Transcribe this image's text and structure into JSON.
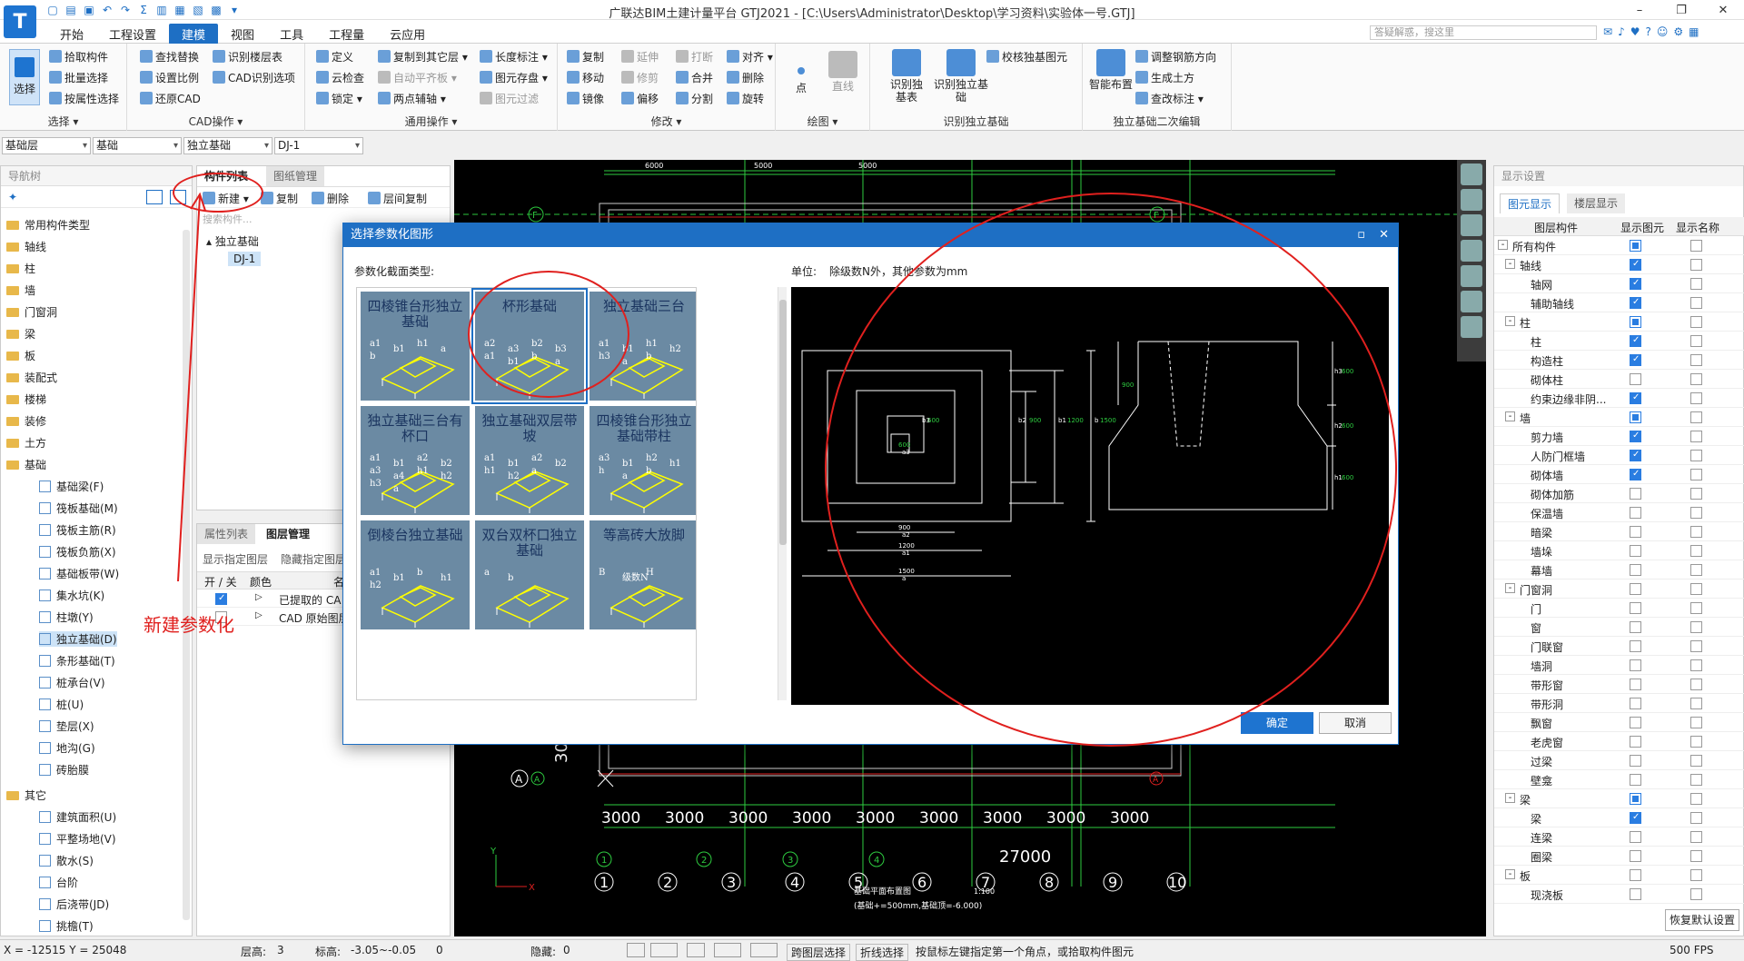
{
  "window": {
    "title": "广联达BIM土建计量平台 GTJ2021 - [C:\\Users\\Administrator\\Desktop\\学习资料\\实验体一号.GTJ]"
  },
  "menu": {
    "tabs": [
      "开始",
      "工程设置",
      "建模",
      "视图",
      "工具",
      "工程量",
      "云应用"
    ],
    "active": "建模",
    "logo": "T",
    "search_placeholder": "答疑解惑，搜这里"
  },
  "ribbon": {
    "select": {
      "label": "选择",
      "items": [
        "拾取构件",
        "批量选择",
        "按属性选择"
      ],
      "group": "选择 ▾"
    },
    "cad": {
      "items": [
        "查找替换",
        "设置比例",
        "还原CAD",
        "识别楼层表",
        "CAD识别选项"
      ],
      "group": "CAD操作 ▾"
    },
    "common": {
      "items": [
        "定义",
        "云检查",
        "锁定 ▾",
        "复制到其它层 ▾",
        "自动平齐板 ▾",
        "两点辅轴 ▾",
        "长度标注 ▾",
        "图元存盘 ▾",
        "图元过滤"
      ],
      "group": "通用操作 ▾"
    },
    "modify": {
      "items": [
        "复制",
        "移动",
        "镜像",
        "延伸",
        "修剪",
        "偏移",
        "打断",
        "合并",
        "分割",
        "对齐 ▾",
        "删除",
        "旋转"
      ],
      "group": "修改 ▾"
    },
    "draw": {
      "items": [
        "点",
        "直线"
      ],
      "group": "绘图 ▾"
    },
    "identify": {
      "items": [
        "识别独基表",
        "识别独立基础",
        "校核独基图元"
      ],
      "group": "识别独立基础"
    },
    "secondary": {
      "items": [
        "智能布置",
        "调整钢筋方向",
        "生成土方",
        "查改标注 ▾"
      ],
      "group": "独立基础二次编辑"
    }
  },
  "combos": [
    "基础层",
    "基础",
    "独立基础",
    "DJ-1"
  ],
  "nav": {
    "title": "导航树",
    "groups": [
      {
        "label": "常用构件类型"
      },
      {
        "label": "轴线"
      },
      {
        "label": "柱"
      },
      {
        "label": "墙"
      },
      {
        "label": "门窗洞"
      },
      {
        "label": "梁"
      },
      {
        "label": "板"
      },
      {
        "label": "装配式"
      },
      {
        "label": "楼梯"
      },
      {
        "label": "装修"
      },
      {
        "label": "土方"
      },
      {
        "label": "基础"
      }
    ],
    "foundation_items": [
      "基础梁(F)",
      "筏板基础(M)",
      "筏板主筋(R)",
      "筏板负筋(X)",
      "基础板带(W)",
      "集水坑(K)",
      "柱墩(Y)",
      "独立基础(D)",
      "条形基础(T)",
      "桩承台(V)",
      "桩(U)",
      "垫层(X)",
      "地沟(G)",
      "砖胎膜"
    ],
    "other_group": "其它",
    "other_items": [
      "建筑面积(U)",
      "平整场地(V)",
      "散水(S)",
      "台阶",
      "后浇带(JD)",
      "挑檐(T)"
    ],
    "selected": "独立基础(D)"
  },
  "component_list": {
    "tabs": [
      "构件列表",
      "图纸管理"
    ],
    "toolbar": [
      "新建 ▾",
      "复制",
      "删除",
      "层间复制"
    ],
    "search_placeholder": "搜索构件...",
    "tree_parent": "独立基础",
    "tree_child": "DJ-1"
  },
  "props": {
    "tabs": [
      "属性列表",
      "图层管理"
    ],
    "toolbar": [
      "显示指定图层",
      "隐藏指定图层"
    ],
    "headers": [
      "开 / 关",
      "颜色",
      "名"
    ],
    "rows": [
      "已提取的 CA",
      "CAD 原始图层"
    ]
  },
  "cad": {
    "dims_top": [
      "6000",
      "5000",
      "5000"
    ],
    "axis_letters": [
      "F",
      "F",
      "A",
      "A",
      "A"
    ],
    "dims_bottom": [
      "3000",
      "3000",
      "3000",
      "3000",
      "3000",
      "3000",
      "3000",
      "3000",
      "3000"
    ],
    "total": "27000",
    "axis_numbers": [
      "1",
      "2",
      "3",
      "4",
      "5",
      "6",
      "7",
      "8",
      "9",
      "10"
    ],
    "axis_numbers_small": [
      "1",
      "2",
      "3",
      "4"
    ],
    "left_dim": "300",
    "note_title": "基础平面布置图",
    "note_scale": "1:100",
    "note": "(基础+=500mm,基础顶=-6.000)"
  },
  "dialog": {
    "title": "选择参数化图形",
    "type_label": "参数化截面类型:",
    "unit_label": "单位:",
    "unit_text": "除级数N外，其他参数为mm",
    "thumbs": [
      {
        "name": "四棱锥台形独立基础",
        "labels": [
          "a1",
          "b1",
          "h1",
          "a",
          "b"
        ]
      },
      {
        "name": "杯形基础",
        "labels": [
          "a2",
          "a3",
          "b2",
          "b3",
          "a1",
          "b1",
          "b",
          "a"
        ]
      },
      {
        "name": "独立基础三台",
        "labels": [
          "a1",
          "b1",
          "h1",
          "h2",
          "h3",
          "a",
          "b"
        ]
      },
      {
        "name": "独立基础三台有杯口",
        "labels": [
          "a1",
          "b1",
          "a2",
          "b2",
          "a3",
          "a4",
          "h1",
          "h2",
          "h3",
          "a"
        ]
      },
      {
        "name": "独立基础双层带坡",
        "labels": [
          "a1",
          "b1",
          "a2",
          "b2",
          "h1",
          "h2",
          "a"
        ]
      },
      {
        "name": "四棱锥台形独立基础带柱",
        "labels": [
          "a3",
          "b1",
          "h2",
          "h1",
          "h",
          "a",
          "b"
        ]
      },
      {
        "name": "倒棱台独立基础",
        "labels": [
          "a1",
          "b1",
          "b",
          "h1",
          "h2"
        ]
      },
      {
        "name": "双台双杯口独立基础",
        "labels": [
          "a",
          "b"
        ]
      },
      {
        "name": "等高砖大放脚",
        "labels": [
          "B",
          "级数N",
          "H"
        ]
      }
    ],
    "selected": "杯形基础",
    "preview": {
      "plan_dims": [
        "600",
        "a3",
        "900",
        "a2",
        "1200",
        "a1",
        "1500",
        "a",
        "600",
        "b3",
        "900",
        "b2",
        "1200",
        "b1",
        "1500",
        "b"
      ],
      "section_dims": [
        "600",
        "h3",
        "600",
        "h2",
        "600",
        "h1",
        "900"
      ]
    },
    "ok": "确定",
    "cancel": "取消"
  },
  "right_panel": {
    "title": "显示设置",
    "tabs": [
      "图元显示",
      "楼层显示"
    ],
    "headers": [
      "图层构件",
      "显示图元",
      "显示名称"
    ],
    "rows": [
      {
        "name": "所有构件",
        "level": 0,
        "toggle": "-",
        "show": "part",
        "name_show": "off"
      },
      {
        "name": "轴线",
        "level": 1,
        "toggle": "-",
        "show": "on",
        "name_show": "off"
      },
      {
        "name": "轴网",
        "level": 2,
        "show": "on",
        "name_show": "off"
      },
      {
        "name": "辅助轴线",
        "level": 2,
        "show": "on",
        "name_show": "off"
      },
      {
        "name": "柱",
        "level": 1,
        "toggle": "-",
        "show": "part",
        "name_show": "off"
      },
      {
        "name": "柱",
        "level": 2,
        "show": "on",
        "name_show": "off"
      },
      {
        "name": "构造柱",
        "level": 2,
        "show": "on",
        "name_show": "off"
      },
      {
        "name": "砌体柱",
        "level": 2,
        "show": "off",
        "name_show": "off"
      },
      {
        "name": "约束边缘非阴...",
        "level": 2,
        "show": "on",
        "name_show": "off"
      },
      {
        "name": "墙",
        "level": 1,
        "toggle": "-",
        "show": "part",
        "name_show": "off"
      },
      {
        "name": "剪力墙",
        "level": 2,
        "show": "on",
        "name_show": "off"
      },
      {
        "name": "人防门框墙",
        "level": 2,
        "show": "on",
        "name_show": "off"
      },
      {
        "name": "砌体墙",
        "level": 2,
        "show": "on",
        "name_show": "off"
      },
      {
        "name": "砌体加筋",
        "level": 2,
        "show": "off",
        "name_show": "off"
      },
      {
        "name": "保温墙",
        "level": 2,
        "show": "off",
        "name_show": "off"
      },
      {
        "name": "暗梁",
        "level": 2,
        "show": "off",
        "name_show": "off"
      },
      {
        "name": "墙垛",
        "level": 2,
        "show": "off",
        "name_show": "off"
      },
      {
        "name": "幕墙",
        "level": 2,
        "show": "off",
        "name_show": "off"
      },
      {
        "name": "门窗洞",
        "level": 1,
        "toggle": "-",
        "show": "off",
        "name_show": "off"
      },
      {
        "name": "门",
        "level": 2,
        "show": "off",
        "name_show": "off"
      },
      {
        "name": "窗",
        "level": 2,
        "show": "off",
        "name_show": "off"
      },
      {
        "name": "门联窗",
        "level": 2,
        "show": "off",
        "name_show": "off"
      },
      {
        "name": "墙洞",
        "level": 2,
        "show": "off",
        "name_show": "off"
      },
      {
        "name": "带形窗",
        "level": 2,
        "show": "off",
        "name_show": "off"
      },
      {
        "name": "带形洞",
        "level": 2,
        "show": "off",
        "name_show": "off"
      },
      {
        "name": "飘窗",
        "level": 2,
        "show": "off",
        "name_show": "off"
      },
      {
        "name": "老虎窗",
        "level": 2,
        "show": "off",
        "name_show": "off"
      },
      {
        "name": "过梁",
        "level": 2,
        "show": "off",
        "name_show": "off"
      },
      {
        "name": "壁龛",
        "level": 2,
        "show": "off",
        "name_show": "off"
      },
      {
        "name": "梁",
        "level": 1,
        "toggle": "-",
        "show": "part",
        "name_show": "off"
      },
      {
        "name": "梁",
        "level": 2,
        "show": "on",
        "name_show": "off"
      },
      {
        "name": "连梁",
        "level": 2,
        "show": "off",
        "name_show": "off"
      },
      {
        "name": "圈梁",
        "level": 2,
        "show": "off",
        "name_show": "off"
      },
      {
        "name": "板",
        "level": 1,
        "toggle": "-",
        "show": "off",
        "name_show": "off"
      },
      {
        "name": "现浇板",
        "level": 2,
        "show": "off",
        "name_show": "off"
      }
    ],
    "reset": "恢复默认设置"
  },
  "status": {
    "coords": "X = -12515 Y = 25048",
    "floor_label": "层高:",
    "floor": "3",
    "elev_label": "标高:",
    "elev": "-3.05~-0.05",
    "zero": "0",
    "hidden_label": "隐藏:",
    "hidden": "0",
    "cross_layer": "跨图层选择",
    "polyline": "折线选择",
    "hint": "按鼠标左键指定第一个角点，或拾取构件图元",
    "fps": "500 FPS"
  },
  "annotation": {
    "text": "新建参数化",
    "color": "#e0201e"
  }
}
